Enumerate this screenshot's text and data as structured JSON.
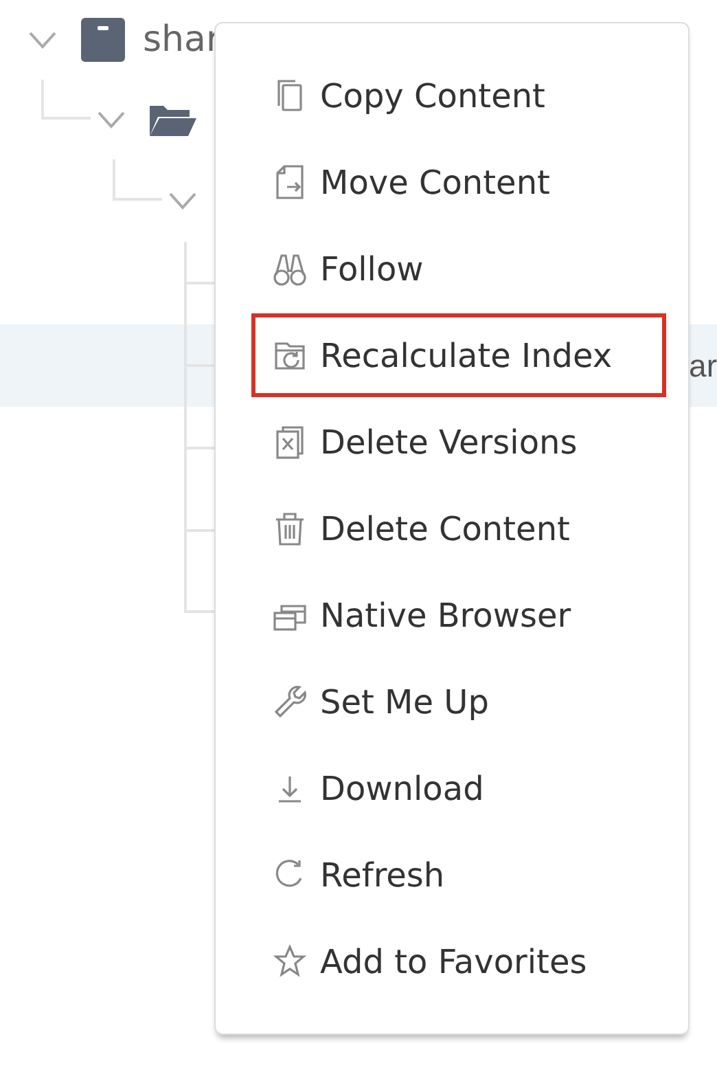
{
  "tree": [
    {
      "label": "shar",
      "kind": "repository",
      "expanded": true,
      "selected": false,
      "children": [
        {
          "kind": "folder",
          "expanded": true,
          "selected": false,
          "children": [
            {
              "expanded": true,
              "selected": false,
              "children": [
                {
                  "selected": false
                },
                {
                  "label": "ar",
                  "selected": true
                },
                {
                  "selected": false
                },
                {
                  "selected": false
                },
                {
                  "selected": false
                }
              ]
            }
          ]
        }
      ]
    }
  ],
  "context_menu": {
    "items": [
      {
        "label": "Copy Content",
        "kind": "copy",
        "highlighted": false
      },
      {
        "label": "Move Content",
        "kind": "move",
        "highlighted": false
      },
      {
        "label": "Follow",
        "kind": "follow",
        "highlighted": false
      },
      {
        "label": "Recalculate Index",
        "kind": "recalc",
        "highlighted": true
      },
      {
        "label": "Delete Versions",
        "kind": "delversions",
        "highlighted": false
      },
      {
        "label": "Delete Content",
        "kind": "delete",
        "highlighted": false
      },
      {
        "label": "Native Browser",
        "kind": "browser",
        "highlighted": false
      },
      {
        "label": "Set Me Up",
        "kind": "setup",
        "highlighted": false
      },
      {
        "label": "Download",
        "kind": "download",
        "highlighted": false
      },
      {
        "label": "Refresh",
        "kind": "refresh",
        "highlighted": false
      },
      {
        "label": "Add to Favorites",
        "kind": "favorite",
        "highlighted": false
      }
    ]
  }
}
